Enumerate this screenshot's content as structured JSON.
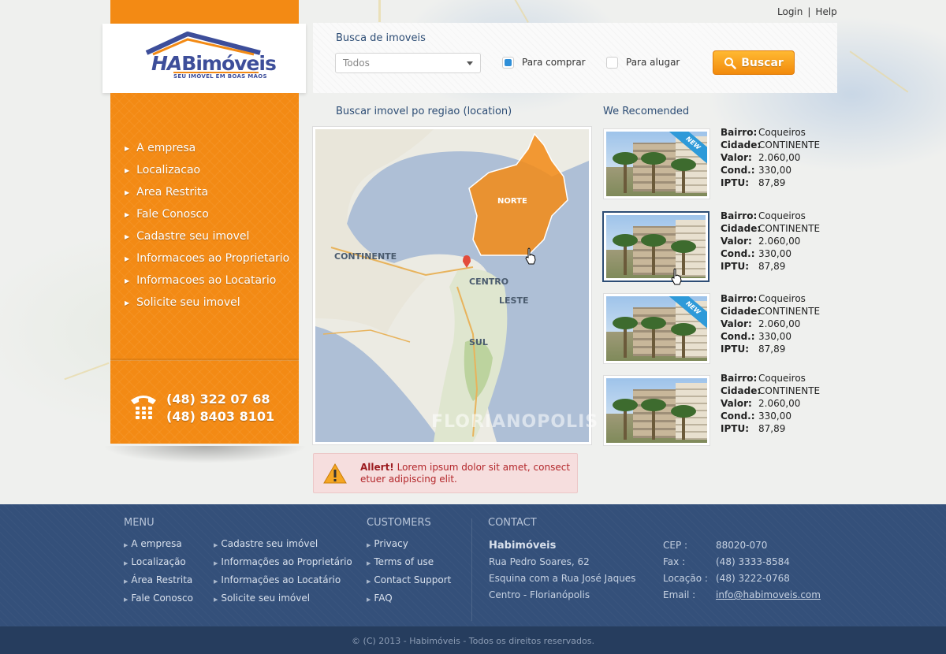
{
  "top_links": {
    "login": "Login",
    "separator": "|",
    "help": "Help"
  },
  "logo": {
    "ha": "HA",
    "name": "Bimóveis",
    "tagline": "SEU IMÓVEL EM BOAS MÃOS"
  },
  "nav": {
    "items": [
      "A empresa",
      "Localizacao",
      "Area Restrita",
      "Fale Conosco",
      "Cadastre seu imovel",
      "Informacoes ao Proprietario",
      "Informacoes ao Locatario",
      "Solicite seu imovel"
    ],
    "phone_1": "(48) 322 07 68",
    "phone_2": "(48) 8403 8101"
  },
  "search": {
    "title": "Busca de imoveis",
    "select_value": "Todos",
    "option_buy": "Para comprar",
    "option_rent": "Para alugar",
    "buy_checked": true,
    "rent_checked": false,
    "button": "Buscar"
  },
  "map": {
    "title": "Buscar imovel po regiao (location)",
    "regions": {
      "continente": "CONTINENTE",
      "centro": "CENTRO",
      "norte": "NORTE",
      "leste": "LESTE",
      "sul": "SUL"
    },
    "watermark": "FLORIANOPOLIS"
  },
  "recommended": {
    "title": "We Recomended",
    "badge": "NEW",
    "labels": {
      "bairro": "Bairro:",
      "cidade": "Cidade:",
      "valor": "Valor:",
      "cond": "Cond.:",
      "iptu": "IPTU:"
    },
    "items": [
      {
        "bairro": "Coqueiros",
        "cidade": "CONTINENTE",
        "valor": "2.060,00",
        "cond": "330,00",
        "iptu": "87,89",
        "new": true
      },
      {
        "bairro": "Coqueiros",
        "cidade": "CONTINENTE",
        "valor": "2.060,00",
        "cond": "330,00",
        "iptu": "87,89",
        "new": false
      },
      {
        "bairro": "Coqueiros",
        "cidade": "CONTINENTE",
        "valor": "2.060,00",
        "cond": "330,00",
        "iptu": "87,89",
        "new": true
      },
      {
        "bairro": "Coqueiros",
        "cidade": "CONTINENTE",
        "valor": "2.060,00",
        "cond": "330,00",
        "iptu": "87,89",
        "new": false
      }
    ]
  },
  "alert": {
    "title": "Allert!",
    "text": "Lorem ipsum dolor sit amet, consect etuer adipiscing elit."
  },
  "footer": {
    "menu_head": "MENU",
    "menu_col1": [
      "A empresa",
      "Localização",
      "Área Restrita",
      "Fale Conosco"
    ],
    "menu_col2": [
      "Cadastre seu imóvel",
      "Informações ao Proprietário",
      "Informações ao Locatário",
      "Solicite seu imóvel"
    ],
    "customers_head": "CUSTOMERS",
    "customers": [
      "Privacy",
      "Terms of use",
      "Contact Support",
      "FAQ"
    ],
    "contact_head": "CONTACT",
    "company": "Habimóveis",
    "address_1": "Rua Pedro Soares, 62",
    "address_2": "Esquina com a Rua José Jaques",
    "address_3": "Centro - Florianópolis",
    "cep_label": "CEP :",
    "cep": "88020-070",
    "fax_label": "Fax :",
    "fax": "(48) 3333-8584",
    "loc_label": "Locação :",
    "loc": "(48) 3222-0768",
    "email_label": "Email :",
    "email": "info@habimoveis.com",
    "copyright": "© (C) 2013 - Habimóveis - Todos os direitos reservados."
  },
  "colors": {
    "orange": "#f38a14",
    "navy": "#34507a",
    "title_blue": "#2d4d75",
    "badge_blue": "#2e9ad9"
  }
}
